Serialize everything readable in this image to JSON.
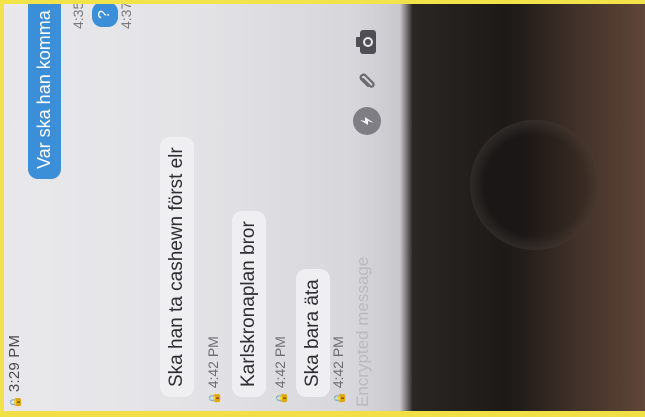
{
  "status_bar": {
    "time": "3:29 PM"
  },
  "conversation": {
    "outgoing": [
      {
        "text": "Var ska han komma bro",
        "time": "4:35"
      },
      {
        "text": "?",
        "time": "4:37"
      }
    ],
    "incoming": [
      {
        "text": "Ska han ta cashewn först elr",
        "time": "4:42 PM"
      },
      {
        "text": "Karlskronaplan bror",
        "time": "4:42 PM"
      },
      {
        "text": "Ska bara äta",
        "time": "4:42 PM"
      }
    ]
  },
  "composer": {
    "placeholder": "Encrypted message",
    "icons": [
      "emoji-icon",
      "attachment-icon",
      "camera-icon"
    ]
  }
}
